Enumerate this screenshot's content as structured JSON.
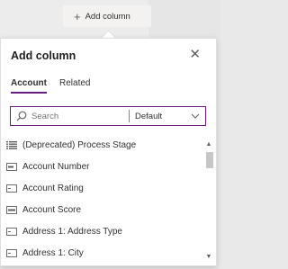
{
  "toolbar": {
    "add_column_label": "Add column",
    "add_column_icon": "plus-icon"
  },
  "panel": {
    "title": "Add column",
    "close_icon": "close-icon",
    "tabs": [
      {
        "label": "Account",
        "active": true
      },
      {
        "label": "Related",
        "active": false
      }
    ],
    "search": {
      "placeholder": "Search",
      "filter_value": "Default"
    },
    "columns": [
      {
        "label": "(Deprecated) Process Stage",
        "icon": "list-icon"
      },
      {
        "label": "Account Number",
        "icon": "text-field-icon"
      },
      {
        "label": "Account Rating",
        "icon": "option-set-icon"
      },
      {
        "label": "Account Score",
        "icon": "number-field-icon"
      },
      {
        "label": "Address 1: Address Type",
        "icon": "option-set-icon"
      },
      {
        "label": "Address 1: City",
        "icon": "text-field-icon"
      }
    ]
  },
  "colors": {
    "accent": "#6b1f7c",
    "panel_bg": "#ffffff",
    "page_bg": "#e9e9e9"
  }
}
